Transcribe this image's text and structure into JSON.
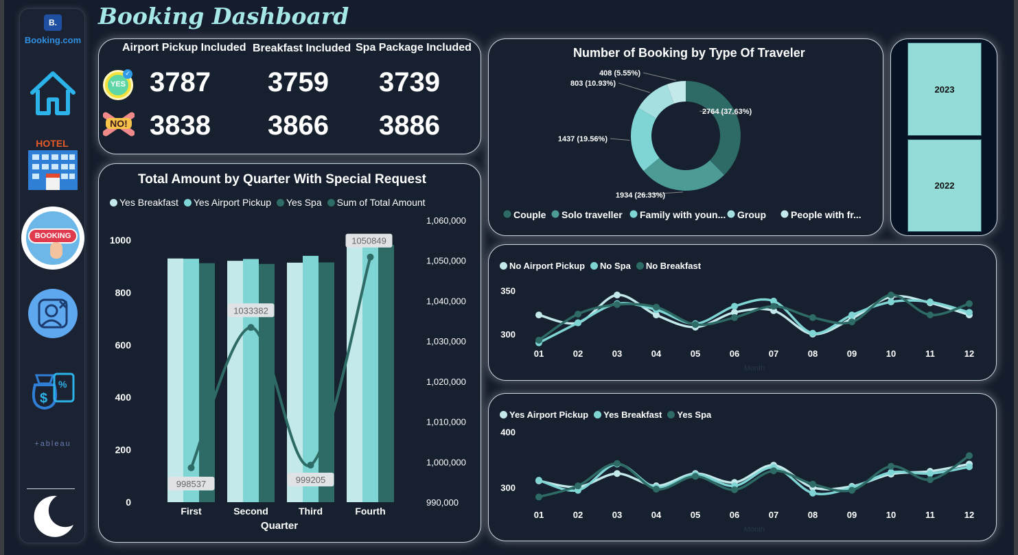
{
  "title": "Booking Dashboard",
  "brand": {
    "logo_letter": "B.",
    "logo_text": "Booking.com"
  },
  "sidebar": {
    "hotel_label": "HOTEL",
    "booking_label": "BOOKING",
    "tableau_label": "+ableau"
  },
  "kpis": {
    "headers": [
      "Airport Pickup Included",
      "Breakfast Included",
      "Spa Package Included"
    ],
    "yes_badge": "YES",
    "no_badge": "NO!",
    "yes": [
      "3787",
      "3759",
      "3739"
    ],
    "no": [
      "3838",
      "3866",
      "3886"
    ]
  },
  "colors": {
    "c1": "#c3e9ea",
    "c2": "#7fd5d4",
    "c3": "#2e6b66",
    "c4": "#4c9c95"
  },
  "slicer": {
    "years": [
      "2023",
      "2022"
    ]
  },
  "chart_data": [
    {
      "id": "quarter",
      "type": "bar",
      "title": "Total Amount by Quarter With Special Request",
      "xlabel": "Quarter",
      "categories": [
        "First",
        "Second",
        "Third",
        "Fourth"
      ],
      "series": [
        {
          "name": "Yes Breakfast",
          "values": [
            930,
            921,
            914,
            983
          ]
        },
        {
          "name": "Yes Airport Pickup",
          "values": [
            929,
            928,
            940,
            985
          ]
        },
        {
          "name": "Yes Spa",
          "values": [
            912,
            909,
            915,
            982
          ]
        }
      ],
      "line_series": {
        "name": "Sum of Total Amount",
        "values": [
          998537,
          1033382,
          999205,
          1050849
        ]
      },
      "ylim": [
        0,
        1000
      ],
      "yticks": [
        "0",
        "200",
        "400",
        "600",
        "800",
        "1000"
      ],
      "y2lim": [
        990000,
        1060000
      ],
      "y2ticks": [
        "990,000",
        "1,000,000",
        "1,010,000",
        "1,020,000",
        "1,030,000",
        "1,040,000",
        "1,050,000",
        "1,060,000"
      ],
      "data_labels": [
        "998537",
        "1033382",
        "999205",
        "1050849"
      ]
    },
    {
      "id": "donut",
      "type": "pie",
      "title": "Number of Booking by Type Of Traveler",
      "legend": [
        "Couple",
        "Solo traveller",
        "Family with youn...",
        "Group",
        "People with fr..."
      ],
      "values": [
        2764,
        1934,
        1437,
        803,
        408
      ],
      "labels": [
        "2764 (37.63%)",
        "1934 (26.33%)",
        "1437 (19.56%)",
        "803 (10.93%)",
        "408 (5.55%)"
      ]
    },
    {
      "id": "no_monthly",
      "type": "line",
      "legend": [
        "No Airport Pickup",
        "No Spa",
        "No Breakfast"
      ],
      "x": [
        "01",
        "02",
        "03",
        "04",
        "05",
        "06",
        "07",
        "08",
        "09",
        "10",
        "11",
        "12"
      ],
      "series": [
        {
          "name": "No Airport Pickup",
          "values": [
            322,
            313,
            345,
            322,
            308,
            325,
            327,
            300,
            318,
            343,
            336,
            322
          ]
        },
        {
          "name": "No Spa",
          "values": [
            290,
            313,
            335,
            328,
            312,
            332,
            338,
            301,
            322,
            337,
            337,
            325
          ]
        },
        {
          "name": "No Breakfast",
          "values": [
            293,
            323,
            334,
            331,
            311,
            319,
            332,
            319,
            314,
            345,
            322,
            335
          ]
        }
      ],
      "ylim": [
        285,
        360
      ],
      "yticks": [
        "300",
        "350"
      ],
      "xlabel": "Month"
    },
    {
      "id": "yes_monthly",
      "type": "line",
      "legend": [
        "Yes Airport Pickup",
        "Yes Breakfast",
        "Yes Spa"
      ],
      "x": [
        "01",
        "02",
        "03",
        "04",
        "05",
        "06",
        "07",
        "08",
        "09",
        "10",
        "11",
        "12"
      ],
      "series": [
        {
          "name": "Yes Airport Pickup",
          "values": [
            312,
            301,
            325,
            303,
            325,
            309,
            340,
            300,
            302,
            324,
            329,
            342
          ]
        },
        {
          "name": "Yes Breakfast",
          "values": [
            313,
            295,
            342,
            300,
            323,
            303,
            336,
            290,
            300,
            327,
            325,
            337
          ]
        },
        {
          "name": "Yes Spa",
          "values": [
            283,
            303,
            343,
            297,
            320,
            296,
            330,
            306,
            295,
            338,
            314,
            357
          ]
        }
      ],
      "ylim": [
        270,
        420
      ],
      "yticks": [
        "300",
        "400"
      ],
      "xlabel": "Month"
    }
  ]
}
